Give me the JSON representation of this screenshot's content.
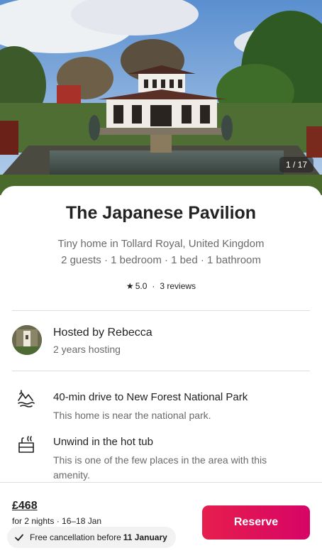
{
  "listing": {
    "photo_counter": "1 / 17",
    "title": "The Japanese Pavilion",
    "subtitle": "Tiny home in Tollard Royal, United Kingdom",
    "details": "2 guests · 1 bedroom · 1 bed · 1 bathroom",
    "rating": "5.0",
    "reviews": "3 reviews"
  },
  "host": {
    "name": "Hosted by Rebecca",
    "tenure": "2 years hosting"
  },
  "features": [
    {
      "icon": "mountain-lake-icon",
      "title": "40-min drive to New Forest National Park",
      "description": "This home is near the national park."
    },
    {
      "icon": "hot-tub-icon",
      "title": "Unwind in the hot tub",
      "description": "This is one of the few places in the area with this amenity."
    }
  ],
  "booking": {
    "price": "£468",
    "dates": "for 2 nights · 16–18 Jan",
    "cancel_text": "Free cancellation before",
    "cancel_date": "11 January",
    "reserve_label": "Reserve"
  },
  "colors": {
    "accent_start": "#e61e4d",
    "accent_end": "#d70466",
    "text_primary": "#222222",
    "text_secondary": "#6a6a6a",
    "divider": "#dddddd"
  }
}
